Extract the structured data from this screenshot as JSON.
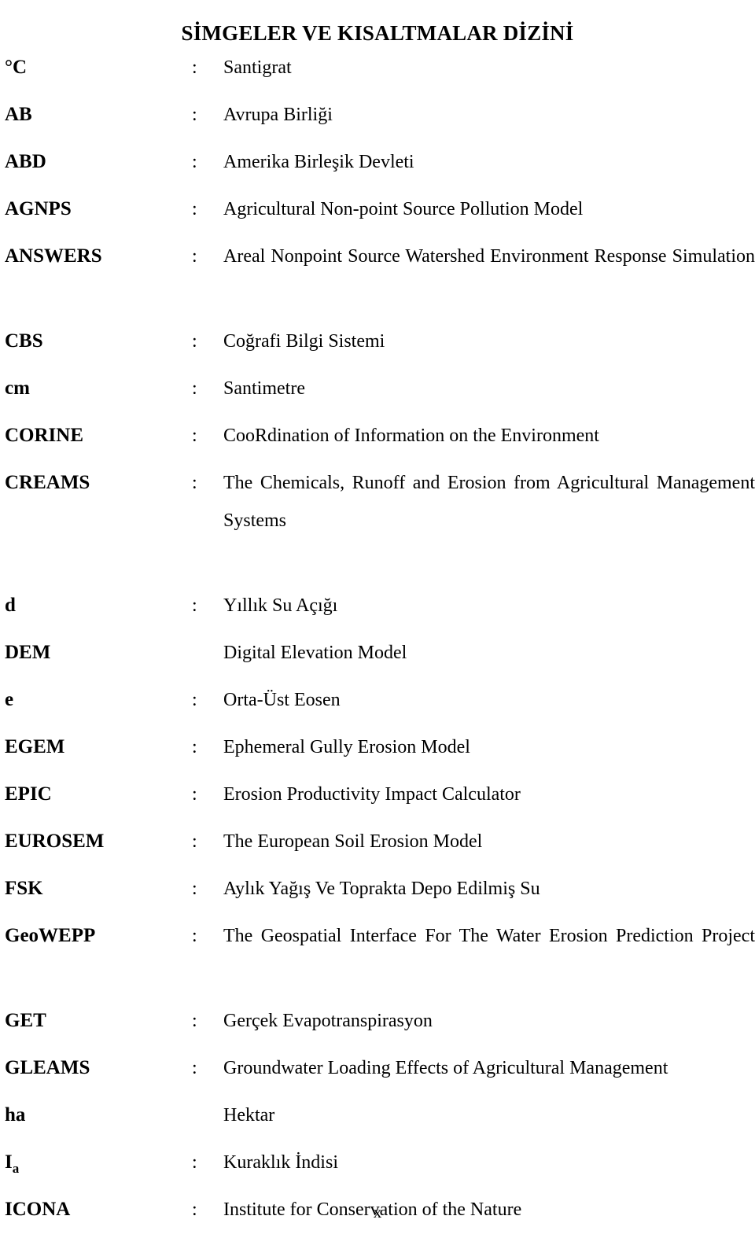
{
  "document": {
    "title": "SİMGELER VE KISALTMALAR DİZİNİ",
    "page_number": "x",
    "separator": ":"
  },
  "entries": [
    {
      "term": "°C",
      "subscript": "",
      "colon": ":",
      "definition": "Santigrat",
      "wraps": false
    },
    {
      "term": "AB",
      "subscript": "",
      "colon": ":",
      "definition": "Avrupa Birliği",
      "wraps": false
    },
    {
      "term": "ABD",
      "subscript": "",
      "colon": ":",
      "definition": "Amerika Birleşik Devleti",
      "wraps": false
    },
    {
      "term": "AGNPS",
      "subscript": "",
      "colon": ":",
      "definition": "Agricultural Non-point Source Pollution Model",
      "wraps": false
    },
    {
      "term": "ANSWERS",
      "subscript": "",
      "colon": ":",
      "definition": "Areal Nonpoint Source Watershed Environment Response Simulation",
      "wraps": true
    },
    {
      "term": "CBS",
      "subscript": "",
      "colon": ":",
      "definition": "Coğrafi Bilgi Sistemi",
      "wraps": false
    },
    {
      "term": "cm",
      "subscript": "",
      "colon": ":",
      "definition": "Santimetre",
      "wraps": false
    },
    {
      "term": "CORINE",
      "subscript": "",
      "colon": ":",
      "definition": "CooRdination of Information on the Environment",
      "wraps": false
    },
    {
      "term": "CREAMS",
      "subscript": "",
      "colon": ":",
      "definition": "The Chemicals, Runoff and Erosion from Agricultural Management Systems",
      "wraps": true
    },
    {
      "term": "d",
      "subscript": "",
      "colon": ":",
      "definition": "Yıllık Su Açığı",
      "wraps": false
    },
    {
      "term": "DEM",
      "subscript": "",
      "colon": "",
      "definition": "Digital Elevation Model",
      "wraps": false
    },
    {
      "term": "e",
      "subscript": "",
      "colon": ":",
      "definition": "Orta-Üst Eosen",
      "wraps": false
    },
    {
      "term": "EGEM",
      "subscript": "",
      "colon": ":",
      "definition": "Ephemeral Gully Erosion Model",
      "wraps": false
    },
    {
      "term": "EPIC",
      "subscript": "",
      "colon": ":",
      "definition": "Erosion Productivity Impact Calculator",
      "wraps": false
    },
    {
      "term": "EUROSEM",
      "subscript": "",
      "colon": ":",
      "definition": "The European Soil Erosion Model",
      "wraps": false
    },
    {
      "term": "FSK",
      "subscript": "",
      "colon": ":",
      "definition": "Aylık Yağış Ve Toprakta Depo Edilmiş Su",
      "wraps": false
    },
    {
      "term": "GeoWEPP",
      "subscript": "",
      "colon": ":",
      "definition": "The Geospatial Interface For The Water Erosion Prediction Project",
      "wraps": true
    },
    {
      "term": "GET",
      "subscript": "",
      "colon": ":",
      "definition": "Gerçek Evapotranspirasyon",
      "wraps": false
    },
    {
      "term": "GLEAMS",
      "subscript": "",
      "colon": ":",
      "definition": "Groundwater Loading Effects of Agricultural Management",
      "wraps": false
    },
    {
      "term": "ha",
      "subscript": "",
      "colon": "",
      "definition": "Hektar",
      "wraps": false
    },
    {
      "term": "I",
      "subscript": "a",
      "colon": ":",
      "definition": "Kuraklık İndisi",
      "wraps": false
    },
    {
      "term": "ICONA",
      "subscript": "",
      "colon": ":",
      "definition": "Institute for Conservation of the Nature",
      "wraps": false
    }
  ]
}
